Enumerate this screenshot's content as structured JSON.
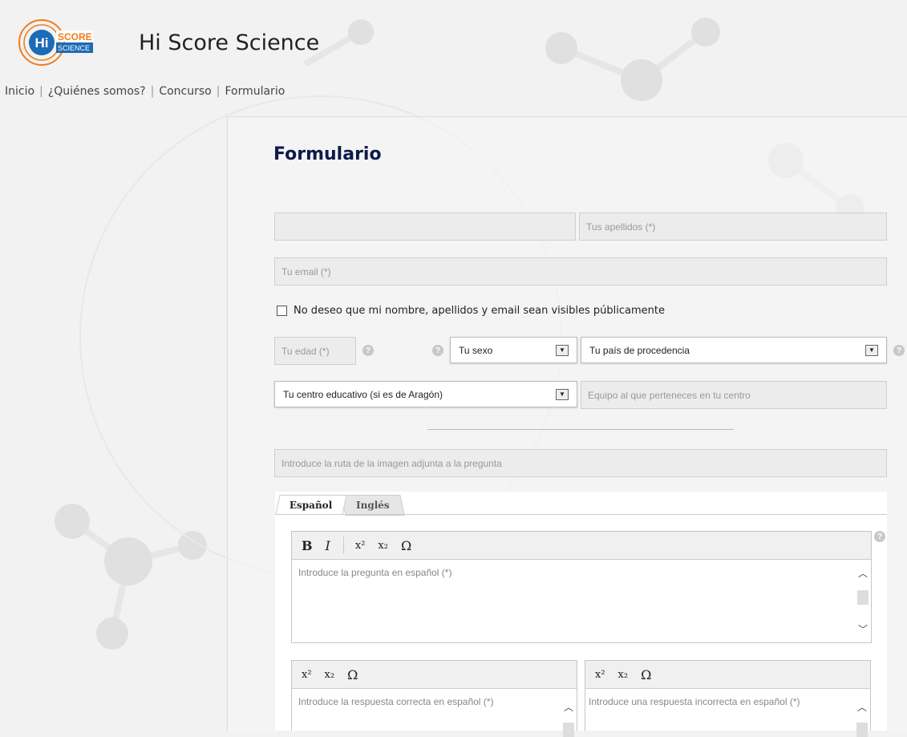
{
  "site": {
    "logo_word_hi": "Hi",
    "logo_word_score": "SCORE",
    "logo_word_science": "SCIENCE",
    "title": "Hi Score Science"
  },
  "nav": {
    "items": [
      {
        "label": "Inicio"
      },
      {
        "label": "¿Quiénes somos?"
      },
      {
        "label": "Concurso"
      },
      {
        "label": "Formulario"
      }
    ]
  },
  "form": {
    "title": "Formulario",
    "name_value": "",
    "surname_placeholder": "Tus apellidos (*)",
    "email_placeholder": "Tu email (*)",
    "privacy_label": "No deseo que mi nombre, apellidos y email sean visibles públicamente",
    "age_placeholder": "Tu edad (*)",
    "sex_select": "Tu sexo",
    "country_select": "Tu país de procedencia",
    "school_select": "Tu centro educativo (si es de Aragón)",
    "team_placeholder": "Equipo al que perteneces en tu centro",
    "image_path_placeholder": "Introduce la ruta de la imagen adjunta a la pregunta",
    "tabs": [
      {
        "label": "Español"
      },
      {
        "label": "Inglés"
      }
    ],
    "question_placeholder": "Introduce la pregunta en español (*)",
    "correct_answer_placeholder": "Introduce la respuesta correcta en español (*)",
    "incorrect_answer_placeholder": "Introduce una respuesta incorrecta en español (*)",
    "help_glyph": "?"
  },
  "toolbar": {
    "bold": "B",
    "italic": "I",
    "superscript": "x²",
    "subscript": "x₂",
    "omega": "Ω"
  },
  "colors": {
    "title": "#0d1a4a",
    "logo_orange": "#f07d1a",
    "logo_blue": "#1c6bb5"
  }
}
